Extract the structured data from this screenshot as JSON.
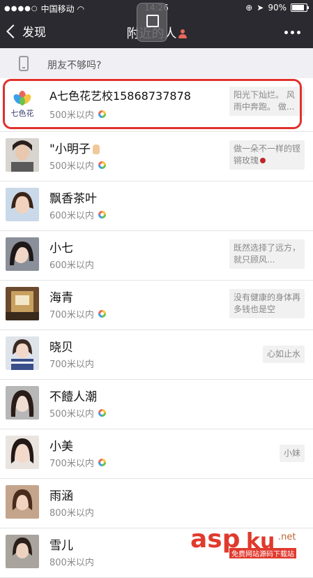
{
  "status_bar": {
    "carrier": "中国移动",
    "time": "14:26",
    "battery": "90%"
  },
  "nav": {
    "back_label": "发现",
    "title": "附近的人"
  },
  "banner": {
    "text": "朋友不够吗?"
  },
  "people": [
    {
      "name": "A七色花艺校15868737878",
      "distance": "500米以内",
      "moments": true,
      "signature": "阳光下灿烂。 风雨中奔跑。 做...",
      "highlighted": true
    },
    {
      "name": "\"小明子",
      "distance": "500米以内",
      "moments": true,
      "signature": "做一朵不一样的铿锵玫瑰"
    },
    {
      "name": "飘香茶叶",
      "distance": "600米以内",
      "moments": true,
      "signature": ""
    },
    {
      "name": "小七",
      "distance": "600米以内",
      "moments": false,
      "signature": "既然选择了远方，就只顾风..."
    },
    {
      "name": "海青",
      "distance": "700米以内",
      "moments": true,
      "signature": "没有健康的身体再多钱也是空"
    },
    {
      "name": "晓贝",
      "distance": "700米以内",
      "moments": false,
      "signature": "心如止水"
    },
    {
      "name": "不饐人潮",
      "distance": "500米以内",
      "moments": true,
      "signature": ""
    },
    {
      "name": "小美",
      "distance": "700米以内",
      "moments": true,
      "signature": "小妹"
    },
    {
      "name": "雨涵",
      "distance": "800米以内",
      "moments": false,
      "signature": ""
    },
    {
      "name": "雪儿",
      "distance": "800米以内",
      "moments": false,
      "signature": ""
    }
  ],
  "watermark": {
    "brand": "asp",
    "brand2": "ku",
    "tld": ".net",
    "tagline": "免费网站源码下载站"
  },
  "colors": {
    "nav_bg": "#2b2a30",
    "highlight": "#e0312b"
  }
}
